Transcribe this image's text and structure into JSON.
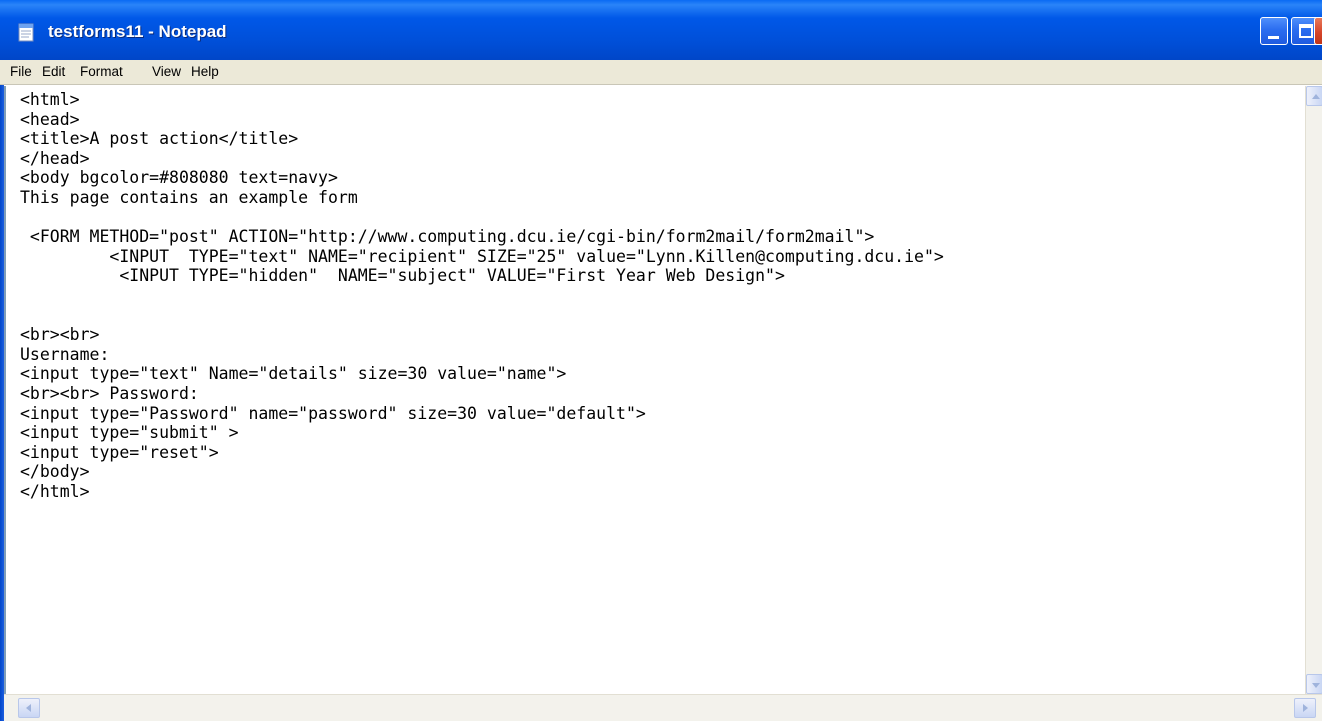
{
  "window": {
    "title": "testforms11 - Notepad",
    "icon": "notepad-icon",
    "controls": [
      "minimize-icon",
      "maximize-icon",
      "close-icon"
    ]
  },
  "menu": {
    "file": "File",
    "edit": "Edit",
    "format": "Format",
    "view": "View",
    "help": "Help"
  },
  "editor": {
    "content": "<html>\n<head>\n<title>A post action</title>\n</head>\n<body bgcolor=#808080 text=navy>\nThis page contains an example form\n\n <FORM METHOD=\"post\" ACTION=\"http://www.computing.dcu.ie/cgi-bin/form2mail/form2mail\">\n         <INPUT  TYPE=\"text\" NAME=\"recipient\" SIZE=\"25\" value=\"Lynn.Killen@computing.dcu.ie\">\n          <INPUT TYPE=\"hidden\"  NAME=\"subject\" VALUE=\"First Year Web Design\">\n\n\n<br><br>\nUsername:\n<input type=\"text\" Name=\"details\" size=30 value=\"name\">\n<br><br> Password:\n<input type=\"Password\" name=\"password\" size=30 value=\"default\">\n<input type=\"submit\" >\n<input type=\"reset\">\n</body>\n</html>"
  },
  "colors": {
    "titlebar": "#0055e5",
    "menubar": "#ece9d8",
    "close_button": "#d6452a",
    "editor_background": "#ffffff"
  }
}
